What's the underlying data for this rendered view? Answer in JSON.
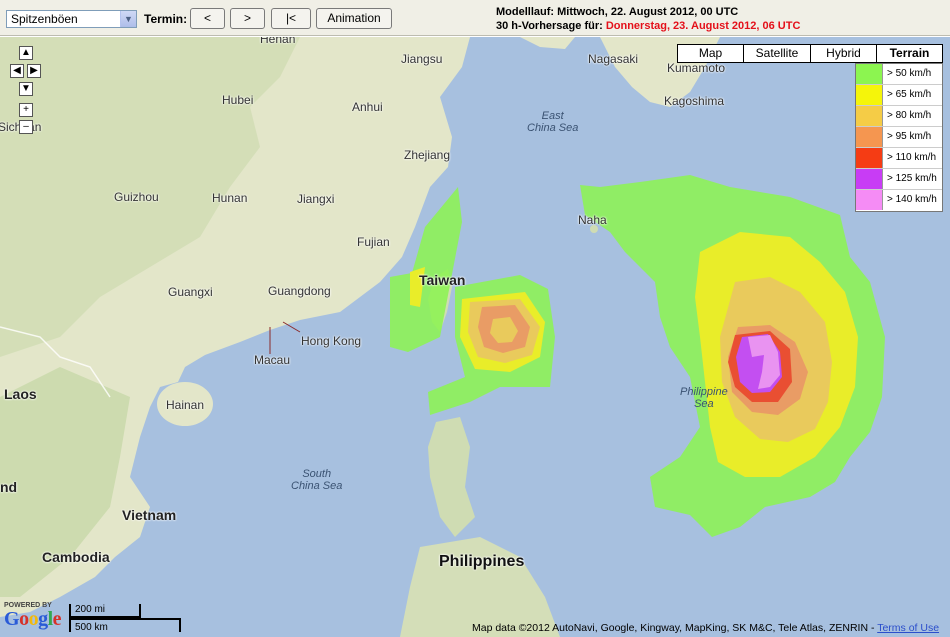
{
  "toolbar": {
    "select_value": "Spitzenböen",
    "termin_label": "Termin:",
    "btn_prev": "<",
    "btn_next": ">",
    "btn_first": "|<",
    "btn_animation": "Animation",
    "model_run": "Modelllauf: Mittwoch, 22. August 2012, 00 UTC",
    "forecast_prefix": "30 h-Vorhersage für: ",
    "forecast_date": "Donnerstag, 23. August 2012, 06 UTC"
  },
  "map_types": [
    {
      "label": "Map",
      "active": false
    },
    {
      "label": "Satellite",
      "active": false
    },
    {
      "label": "Hybrid",
      "active": false
    },
    {
      "label": "Terrain",
      "active": true
    }
  ],
  "legend": [
    {
      "label": "> 50 km/h",
      "color": "#8cf550"
    },
    {
      "label": "> 65 km/h",
      "color": "#f5f50a"
    },
    {
      "label": "> 80 km/h",
      "color": "#f5cc46"
    },
    {
      "label": "> 95 km/h",
      "color": "#f59650"
    },
    {
      "label": "> 110 km/h",
      "color": "#f53c14"
    },
    {
      "label": "> 125 km/h",
      "color": "#c83cf5"
    },
    {
      "label": "> 140 km/h",
      "color": "#f58cf5"
    }
  ],
  "controls": {
    "up": "▲",
    "left": "◀",
    "right": "▶",
    "down": "▼",
    "zoom_in": "+",
    "zoom_out": "–"
  },
  "places": {
    "henan": "Henan",
    "jiangsu": "Jiangsu",
    "hubei": "Hubei",
    "anhui": "Anhui",
    "sichuan": "Sichuan",
    "zhejiang": "Zhejiang",
    "guizhou": "Guizhou",
    "hunan": "Hunan",
    "jiangxi": "Jiangxi",
    "fujian": "Fujian",
    "taiwan": "Taiwan",
    "guangxi": "Guangxi",
    "guangdong": "Guangdong",
    "hong_kong": "Hong Kong",
    "macau": "Macau",
    "laos": "Laos",
    "hainan": "Hainan",
    "vietnam": "Vietnam",
    "cambodia": "Cambodia",
    "ind": "nd",
    "philippines": "Philippines",
    "nagasaki": "Nagasaki",
    "kumamoto": "Kumamoto",
    "kagoshima": "Kagoshima",
    "naha": "Naha",
    "east_china_sea_1": "East",
    "east_china_sea_2": "China Sea",
    "south_china_sea_1": "South",
    "south_china_sea_2": "China Sea",
    "philippine_sea_1": "Philippine",
    "philippine_sea_2": "Sea"
  },
  "footer": {
    "powered_by": "POWERED BY",
    "google": "Google",
    "scale_mi": "200 mi",
    "scale_km": "500 km",
    "attribution": "Map data ©2012 AutoNavi, Google, Kingway, MapKing, SK M&C, Tele Atlas, ZENRIN - ",
    "terms": "Terms of Use"
  }
}
